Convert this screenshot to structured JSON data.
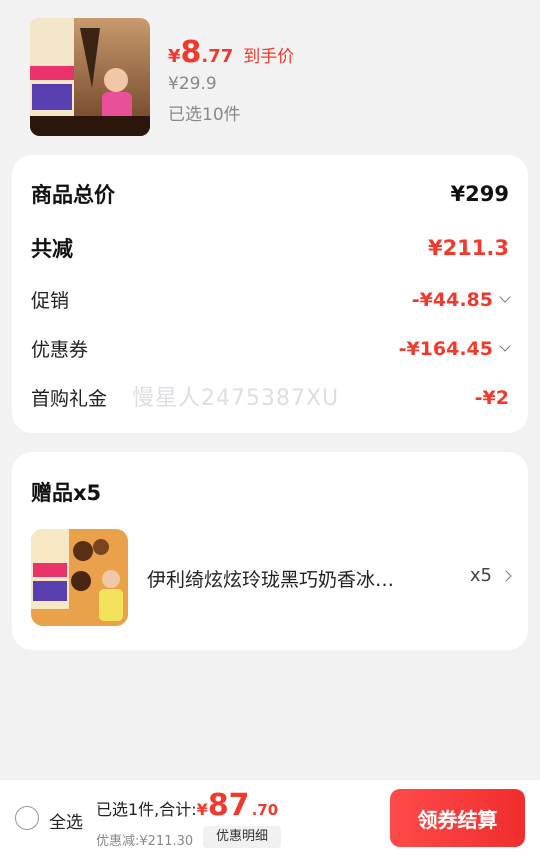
{
  "product": {
    "image_icon": "chocolate-ice-cream-product-image",
    "price_yen": "¥",
    "price_int": "8",
    "price_dec": ".77",
    "price_tag": "到手价",
    "original_price": "¥29.9",
    "selected_count": "已选10件"
  },
  "summary": {
    "total_label": "商品总价",
    "total_value": "¥299",
    "reduce_label": "共减",
    "reduce_value": "¥211.3",
    "promo_label": "促销",
    "promo_value": "-¥44.85",
    "coupon_label": "优惠券",
    "coupon_value": "-¥164.45",
    "first_buy_label": "首购礼金",
    "first_buy_value": "-¥2",
    "watermark": "慢星人2475387XU"
  },
  "gift": {
    "title": "赠品x5",
    "image_icon": "gift-ice-cream-product-image",
    "name": "伊利绮炫炫玲珑黑巧奶香冰…",
    "quantity": "x5"
  },
  "bottom_bar": {
    "select_all": "全选",
    "selected_total_label": "已选1件,合计:",
    "total_yen": "¥",
    "total_int": "87",
    "total_dec": ".70",
    "discount": "优惠减:¥211.30",
    "detail_button": "优惠明细",
    "checkout_button": "领券结算"
  },
  "colors": {
    "accent": "#f03a2e",
    "background": "#f2f2f2",
    "card": "#ffffff"
  }
}
